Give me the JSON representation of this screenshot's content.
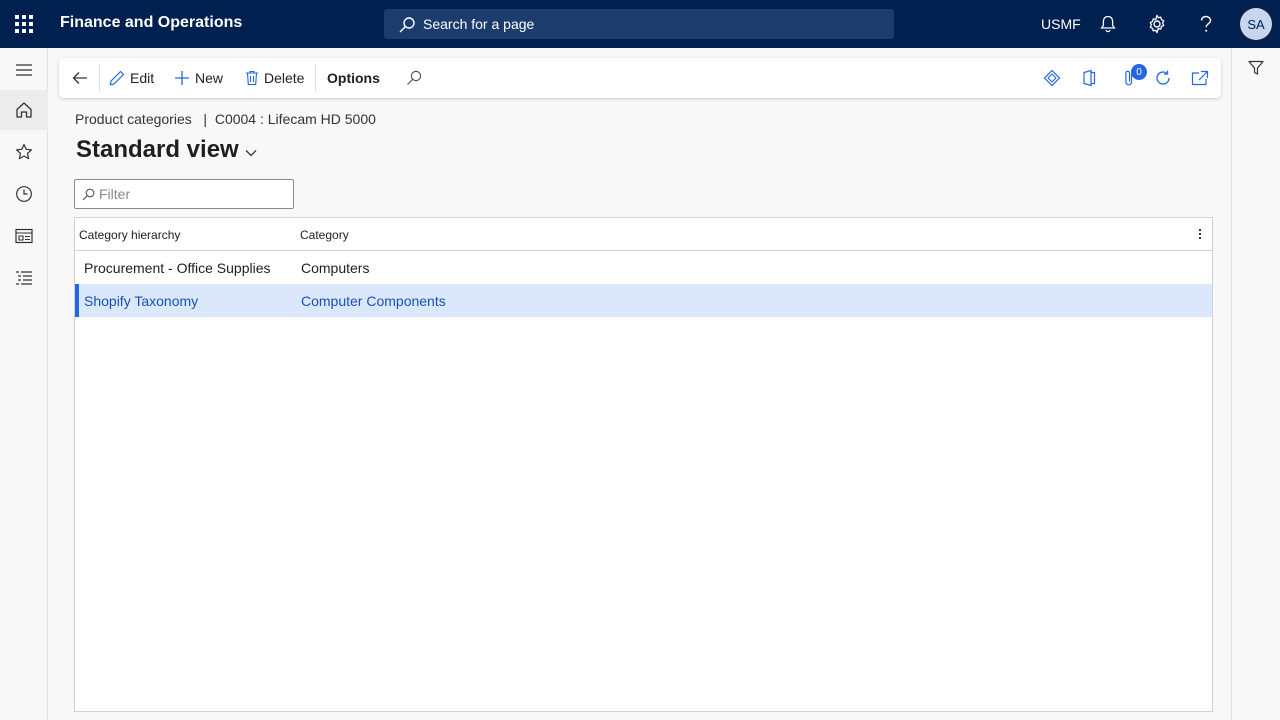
{
  "app": {
    "title": "Finance and Operations"
  },
  "search": {
    "placeholder": "Search for a page"
  },
  "header": {
    "company": "USMF",
    "avatar_initials": "SA"
  },
  "actions": {
    "edit": "Edit",
    "new": "New",
    "delete": "Delete",
    "options": "Options",
    "attachments_count": "0"
  },
  "breadcrumb": {
    "parent": "Product categories",
    "separator": "|",
    "current": "C0004 : Lifecam HD 5000"
  },
  "view": {
    "title": "Standard view"
  },
  "filter": {
    "placeholder": "Filter"
  },
  "grid": {
    "columns": [
      "Category hierarchy",
      "Category"
    ],
    "rows": [
      {
        "hierarchy": "Procurement - Office Supplies",
        "category": "Computers"
      },
      {
        "hierarchy": "Shopify Taxonomy",
        "category": "Computer Components"
      }
    ],
    "selected_row": 1
  },
  "colors": {
    "topbar": "#002050",
    "accent": "#2266e3",
    "selected_row": "#dbe7fb"
  }
}
